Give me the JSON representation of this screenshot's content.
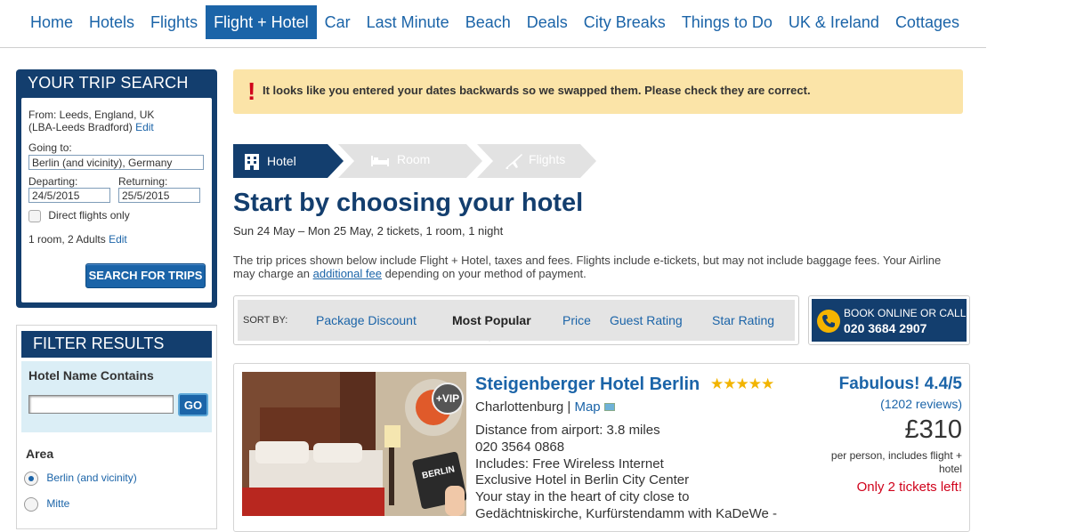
{
  "nav": {
    "items": [
      "Home",
      "Hotels",
      "Flights",
      "Flight + Hotel",
      "Car",
      "Last Minute",
      "Beach",
      "Deals",
      "City Breaks",
      "Things to Do",
      "UK & Ireland",
      "Cottages"
    ],
    "active": "Flight + Hotel"
  },
  "trip_search": {
    "title": "YOUR TRIP SEARCH",
    "from_label": "From: Leeds, England, UK",
    "from_airport": "(LBA-Leeds Bradford)",
    "edit_label": "Edit",
    "going_to_label": "Going to:",
    "going_to_value": "Berlin (and vicinity), Germany",
    "departing_label": "Departing:",
    "departing_value": "24/5/2015",
    "returning_label": "Returning:",
    "returning_value": "25/5/2015",
    "direct_flights_label": "Direct flights only",
    "rooms_text": "1 room, 2 Adults",
    "rooms_edit": "Edit",
    "search_button": "SEARCH FOR TRIPS"
  },
  "filter": {
    "title": "FILTER RESULTS",
    "hotel_name_label": "Hotel Name Contains",
    "go_button": "GO",
    "area_label": "Area",
    "area_options": [
      "Berlin (and vicinity)",
      "Mitte"
    ]
  },
  "alert": {
    "icon": "!",
    "message": "It looks like you entered your dates backwards so we swapped them. Please check they are correct."
  },
  "steps": [
    "Hotel",
    "Room",
    "Flights"
  ],
  "main": {
    "title": "Start by choosing your hotel",
    "subtitle": "Sun 24 May – Mon 25 May, 2 tickets, 1 room, 1 night",
    "note_before": "The trip prices shown below include Flight + Hotel, taxes and fees. Flights include e-tickets, but may not include baggage fees. Your Airline may charge an ",
    "note_link": "additional fee",
    "note_after": " depending on your method of payment."
  },
  "sort": {
    "label": "SORT BY:",
    "options": [
      "Package Discount",
      "Most Popular",
      "Price",
      "Guest Rating",
      "Star Rating"
    ],
    "selected": "Most Popular"
  },
  "call": {
    "line1": "BOOK ONLINE OR CALL",
    "phone": "020 3684 2907"
  },
  "hotel": {
    "name": "Steigenberger Hotel Berlin",
    "stars": 5,
    "stars_text": "★★★★★",
    "vip_badge": "+VIP",
    "card_text": "BERLIN",
    "district": "Charlottenburg",
    "map_label": "Map",
    "distance": "Distance from airport: 3.8 miles",
    "phone": "020 3564 0868",
    "includes": "Includes: Free Wireless Internet",
    "desc1": "Exclusive Hotel in Berlin City Center",
    "desc2": "Your stay in the heart of city close to",
    "desc3": "Gedächtniskirche, Kurfürstendamm with KaDeWe -",
    "rating_word": "Fabulous!",
    "rating_value": "4.4/5",
    "reviews": "(1202 reviews)",
    "price": "£310",
    "price_note": "per person,  includes flight + hotel",
    "availability": "Only 2 tickets left!"
  },
  "colors": {
    "brand_blue": "#1b64a8",
    "navy": "#133e6e",
    "alert_bg": "#fbe4a8",
    "alert_red": "#d0021b",
    "star_gold": "#f2b400"
  }
}
